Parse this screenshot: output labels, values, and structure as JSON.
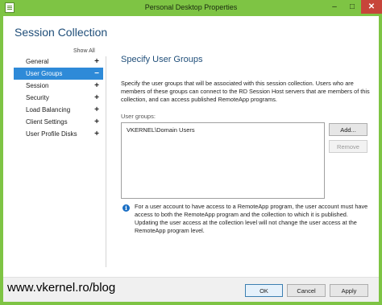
{
  "window": {
    "title": "Personal Desktop Properties",
    "minimize_glyph": "–",
    "maximize_glyph": "□",
    "close_glyph": "✕",
    "accent_color": "#7ec444",
    "close_color": "#c7453a",
    "app_icon": "properties-icon"
  },
  "collection_title": "Session Collection",
  "nav": {
    "show_all": "Show All",
    "items": [
      {
        "label": "General",
        "sign": "+"
      },
      {
        "label": "User Groups",
        "sign": "−",
        "selected": true
      },
      {
        "label": "Session",
        "sign": "+"
      },
      {
        "label": "Security",
        "sign": "+"
      },
      {
        "label": "Load Balancing",
        "sign": "+"
      },
      {
        "label": "Client Settings",
        "sign": "+"
      },
      {
        "label": "User Profile Disks",
        "sign": "+"
      }
    ],
    "selected_color": "#2e8ad8"
  },
  "main": {
    "heading": "Specify User Groups",
    "description": "Specify the user groups that will be associated with this session collection. Users who are members of these groups can connect to the RD Session Host servers that are members of this collection, and can access published RemoteApp programs.",
    "groups_label": "User groups:",
    "groups": [
      "VKERNEL\\Domain Users"
    ],
    "add_label": "Add...",
    "remove_label": "Remove",
    "info_icon": "info-icon",
    "info_text": "For a user account to have access to a RemoteApp program, the user account must have access to both the RemoteApp program and the collection to which it is published. Updating the user access at the collection level will not change the user access at the RemoteApp program level."
  },
  "footer": {
    "ok_label": "OK",
    "cancel_label": "Cancel",
    "apply_label": "Apply"
  },
  "watermark": "www.vkernel.ro/blog"
}
